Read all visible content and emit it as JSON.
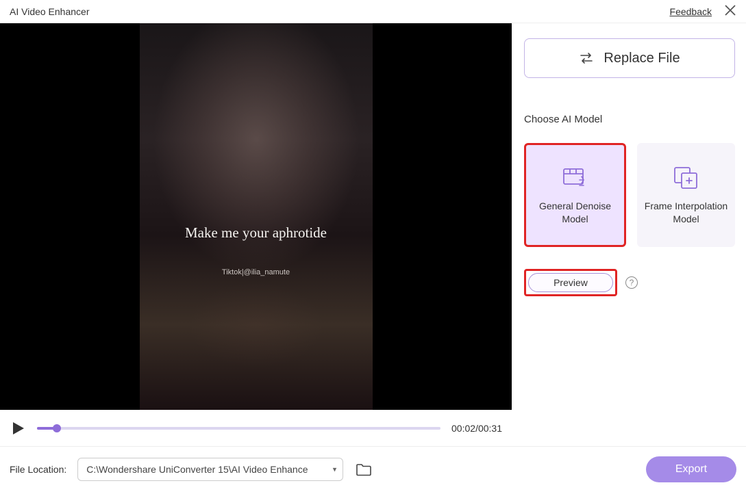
{
  "header": {
    "title": "AI Video Enhancer",
    "feedback": "Feedback"
  },
  "video": {
    "overlay_text": "Make me your aphrotide",
    "tag": "Tiktok|@ilia_namute",
    "current_time": "00:02",
    "total_time": "00:31"
  },
  "side": {
    "replace_label": "Replace File",
    "section_label": "Choose AI Model",
    "models": [
      {
        "label": "General Denoise Model",
        "selected": true
      },
      {
        "label": "Frame Interpolation Model",
        "selected": false
      }
    ],
    "preview_label": "Preview"
  },
  "footer": {
    "location_label": "File Location:",
    "location_value": "C:\\Wondershare UniConverter 15\\AI Video Enhance",
    "export_label": "Export"
  }
}
